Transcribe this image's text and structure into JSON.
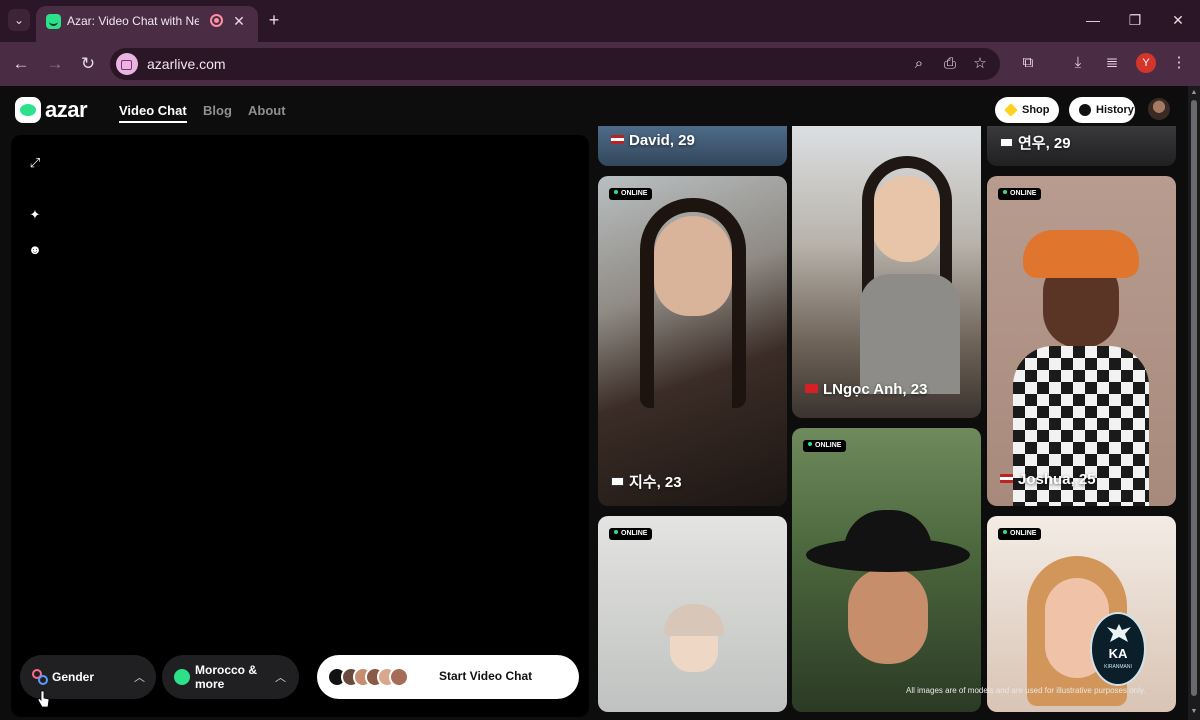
{
  "browser": {
    "tab_title": "Azar: Video Chat with New Friends",
    "tab_close": "✕",
    "new_tab": "+",
    "url": "azarlive.com",
    "profile_initial": "Y",
    "icons": [
      "tab-list-icon",
      "back-icon",
      "forward-icon",
      "reload-icon",
      "zoom-icon",
      "install-app-icon",
      "star-icon",
      "extensions-icon",
      "download-icon",
      "media-icon",
      "menu-icon",
      "minimize-icon",
      "maximize-icon",
      "close-icon"
    ]
  },
  "site": {
    "logo": "azar",
    "nav": [
      "Video Chat",
      "Blog",
      "About"
    ],
    "shop_label": "Shop",
    "history_label": "History"
  },
  "video_panel": {
    "gender_label": "Gender",
    "region_label_line1": "Morocco &",
    "region_label_line2": "more",
    "start_label": "Start Video Chat"
  },
  "cards": {
    "badge": "ONLINE",
    "top_left_name": "David, 29",
    "top_right_name": "연우, 29",
    "c1_name": "지수, 23",
    "c2_name": "LNgọc Anh, 23",
    "c3_name": "Joshua, 25"
  },
  "disclaimer": "All images are of models and are used for illustrative purposes only.",
  "watermark": {
    "text": "KA",
    "sub": "KIRANMANI"
  },
  "colors": {
    "accent": "#2de08a",
    "browser_frame": "#4a2d45",
    "page_bg": "#0d0d0e"
  }
}
